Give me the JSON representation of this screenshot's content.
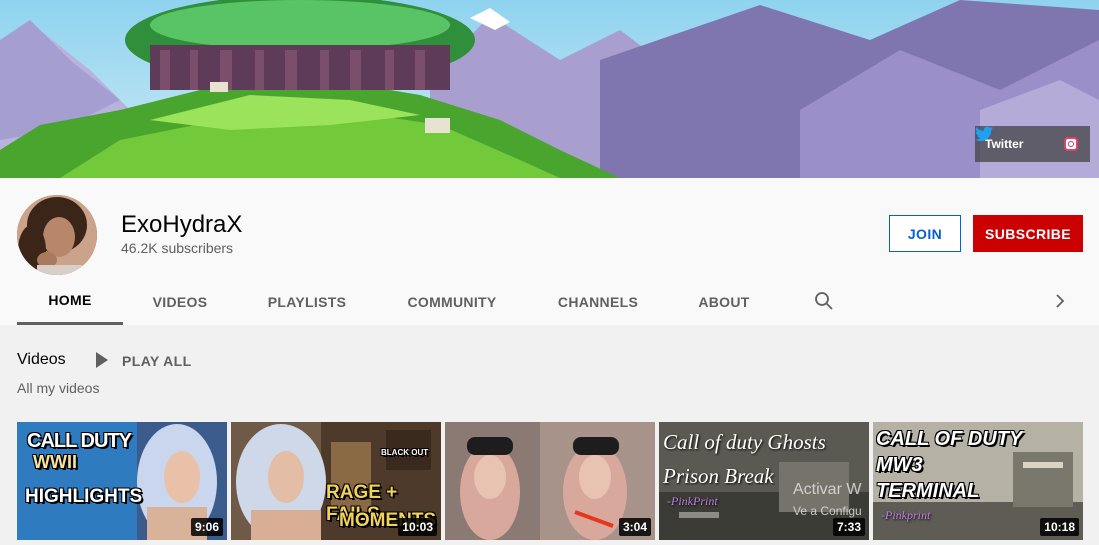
{
  "banner": {
    "social": {
      "twitter_label": "Twitter"
    }
  },
  "channel": {
    "name": "ExoHydraX",
    "subscribers": "46.2K subscribers",
    "join_label": "JOIN",
    "subscribe_label": "SUBSCRIBE"
  },
  "tabs": [
    "HOME",
    "VIDEOS",
    "PLAYLISTS",
    "COMMUNITY",
    "CHANNELS",
    "ABOUT"
  ],
  "section": {
    "title": "Videos",
    "play_all": "PLAY ALL",
    "subtitle": "All my videos"
  },
  "videos": [
    {
      "title_line1": "CALL DUTY",
      "title_line2": "WWII",
      "title_line3": "HIGHLIGHTS",
      "duration": "9:06"
    },
    {
      "title_line1": "BLACK OUT",
      "title_line2": "RAGE + FAILS",
      "title_line3": "MOMENTS",
      "duration": "10:03"
    },
    {
      "duration": "3:04"
    },
    {
      "title_line1": "Call of duty Ghosts",
      "title_line2": "Prison Break",
      "title_line3": "-PinkPrint",
      "duration": "7:33"
    },
    {
      "title_line1": "CALL OF DUTY",
      "title_line2": "MW3",
      "title_line3": "TERMINAL",
      "title_line4": "-Pinkprint",
      "duration": "10:18"
    }
  ],
  "watermark": {
    "line1": "Activar W",
    "line2": "Ve a Configu"
  },
  "colors": {
    "subscribe": "#cc0000",
    "join": "#065fd4"
  }
}
